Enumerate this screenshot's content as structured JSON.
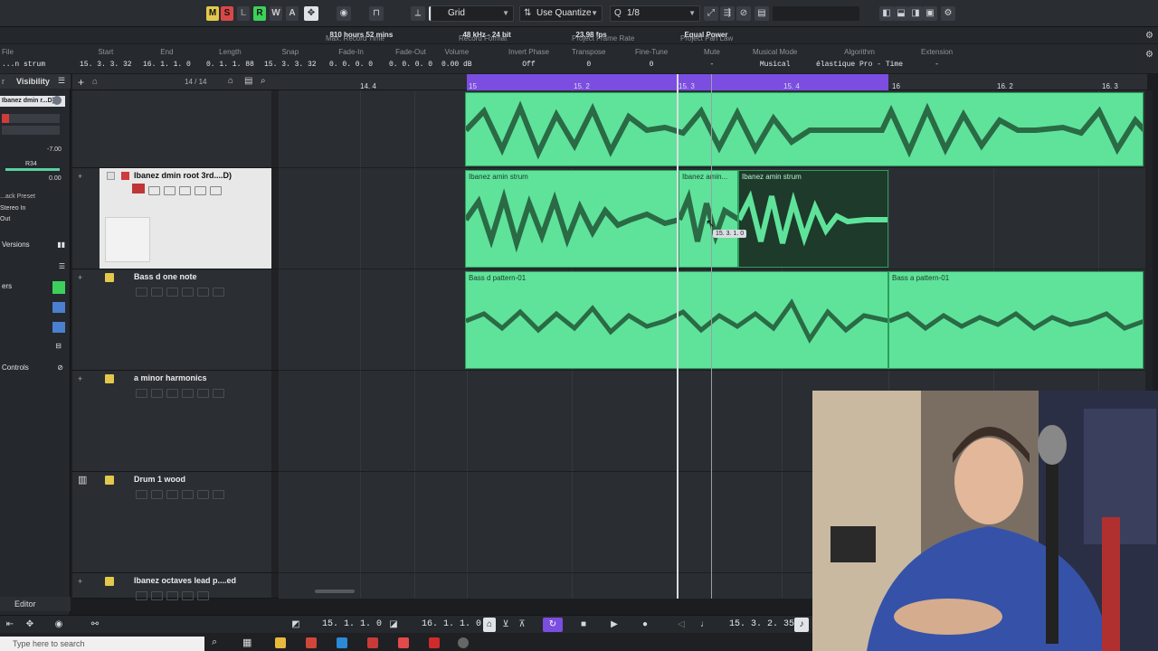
{
  "toolbar": {
    "buttons": [
      "M",
      "S",
      "L",
      "R",
      "W",
      "A"
    ],
    "snap_type": "Grid",
    "quantize_mode": "Use Quantize",
    "quantize_value": "1/8"
  },
  "infoline": {
    "max_record_time_label": "Max. Record Time",
    "max_record_time_value": "810 hours 52 mins",
    "record_format_label": "Record Format",
    "record_format_value": "48 kHz - 24 bit",
    "frame_rate_label": "Project Frame Rate",
    "frame_rate_value": "23.98 fps",
    "pan_law_label": "Project Pan Law",
    "pan_law_value": "Equal Power"
  },
  "event_info": [
    {
      "label": "File",
      "value": "...n strum"
    },
    {
      "label": "Start",
      "value": "15. 3. 3. 32"
    },
    {
      "label": "End",
      "value": "16. 1. 1. 0"
    },
    {
      "label": "Length",
      "value": "0. 1. 1. 88"
    },
    {
      "label": "Snap",
      "value": "15. 3. 3. 32"
    },
    {
      "label": "Fade-In",
      "value": "0. 0. 0. 0"
    },
    {
      "label": "Fade-Out",
      "value": "0. 0. 0. 0"
    },
    {
      "label": "Volume",
      "value": "0.00  dB"
    },
    {
      "label": "Invert Phase",
      "value": "Off"
    },
    {
      "label": "Transpose",
      "value": "0"
    },
    {
      "label": "Fine-Tune",
      "value": "0"
    },
    {
      "label": "Mute",
      "value": "-"
    },
    {
      "label": "Musical Mode",
      "value": "Musical"
    },
    {
      "label": "Algorithm",
      "value": "élastique Pro - Time"
    },
    {
      "label": "Extension",
      "value": "-"
    }
  ],
  "inspector": {
    "tab_label": "Visibility",
    "track_name": "Ibanez dmin r...D)",
    "fader_value": "-7.00",
    "pan_value": "R34",
    "volume_value": "0.00",
    "track_preset": "...ack Preset",
    "input": "Stereo In",
    "output": "Out",
    "sections": [
      "Versions",
      "ers",
      "Controls"
    ],
    "editor_tab": "Editor"
  },
  "tracklist": {
    "count": "14 / 14",
    "tracks": [
      {
        "name": ""
      },
      {
        "name": "Ibanez dmin root 3rd....D)"
      },
      {
        "name": "Bass d one note"
      },
      {
        "name": "a minor harmonics"
      },
      {
        "name": "Drum 1 wood"
      },
      {
        "name": "Ibanez octaves lead p....ed"
      }
    ]
  },
  "ruler": {
    "ticks": [
      "14. 4",
      "15",
      "15. 2",
      "15. 3",
      "15. 4",
      "16",
      "16. 2",
      "16. 3"
    ]
  },
  "clips": {
    "lane2_clip1": "Ibanez amin strum",
    "lane2_clip2": "Ibanez amin...",
    "lane2_clip3": "Ibanez amin strum",
    "lane3_clip1": "Bass d pattern-01",
    "lane3_clip2": "Bass a pattern-01"
  },
  "tooltip": "15. 3. 1. 0",
  "transport": {
    "left_locator": "15. 1. 1.  0",
    "right_locator": "16. 1. 1.  0",
    "position": "15. 3. 2. 35"
  },
  "taskbar": {
    "search_placeholder": "Type here to search"
  },
  "colors": {
    "clip_green": "#5fe39a",
    "loop_purple": "#7b4de0",
    "mute_yellow": "#e3c84d",
    "record_red": "#d03b3b"
  }
}
